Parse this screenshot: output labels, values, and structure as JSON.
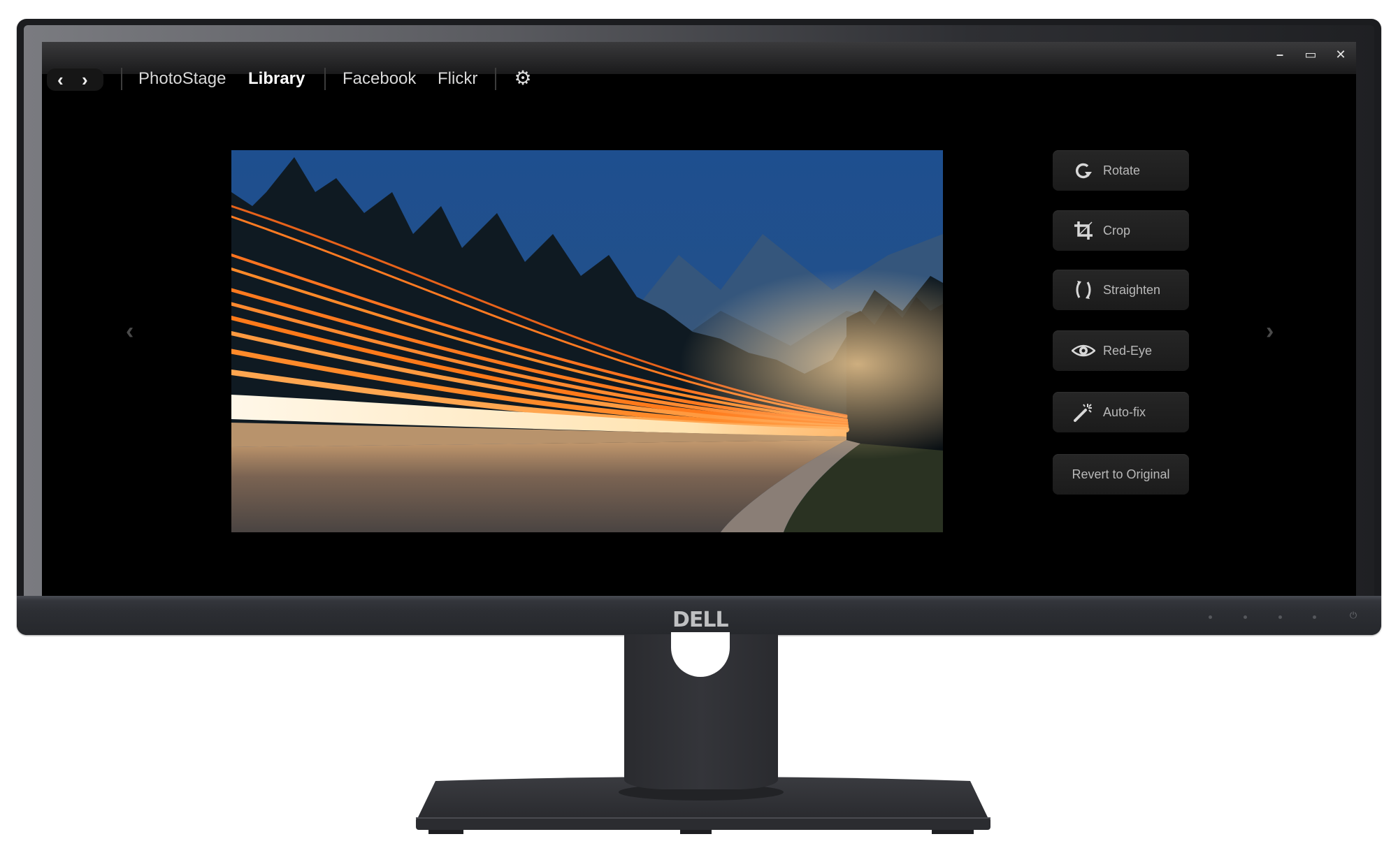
{
  "device": {
    "brand_logo": "DELL",
    "bezel_buttons": [
      "menu-button-1",
      "menu-button-2",
      "menu-button-3",
      "menu-button-4"
    ],
    "power_icon": "⏻"
  },
  "window_controls": {
    "minimize": "–",
    "maximize": "▭",
    "close": "✕"
  },
  "nav": {
    "back_icon": "‹",
    "forward_icon": "›",
    "tabs": [
      {
        "label": "PhotoStage",
        "active": false
      },
      {
        "label": "Library",
        "active": true
      },
      {
        "label": "Facebook",
        "active": false
      },
      {
        "label": "Flickr",
        "active": false
      }
    ],
    "settings_icon": "⚙"
  },
  "viewer": {
    "prev_icon": "‹",
    "next_icon": "›",
    "photo_description": "Long-exposure light trails on a mountain highway at dusk"
  },
  "tools": [
    {
      "id": "rotate",
      "label": "Rotate",
      "icon": "rotate-icon"
    },
    {
      "id": "crop",
      "label": "Crop",
      "icon": "crop-icon"
    },
    {
      "id": "straighten",
      "label": "Straighten",
      "icon": "straighten-icon"
    },
    {
      "id": "red-eye",
      "label": "Red-Eye",
      "icon": "eye-icon"
    },
    {
      "id": "auto-fix",
      "label": "Auto-fix",
      "icon": "magic-wand-icon"
    },
    {
      "id": "revert",
      "label": "Revert to Original",
      "icon": ""
    }
  ],
  "colors": {
    "app_background": "#000000",
    "button_background": "#1e1e1e",
    "button_text": "#b9b9b9",
    "active_tab": "#ffffff",
    "inactive_tab": "#d8d8d8",
    "light_trail": "#ff7a1a"
  }
}
